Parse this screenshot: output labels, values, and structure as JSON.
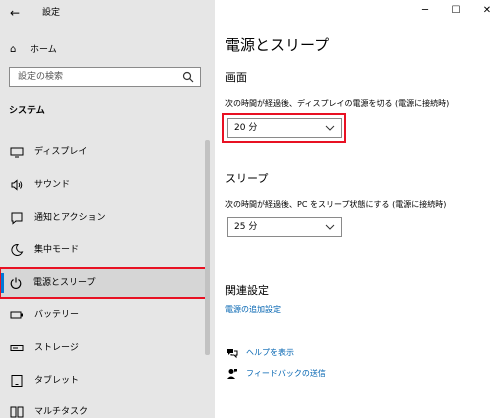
{
  "app": {
    "title": "設定"
  },
  "sidebar": {
    "home_label": "ホーム",
    "search_placeholder": "設定の検索",
    "section": "システム",
    "items": [
      {
        "label": "ディスプレイ",
        "icon": "monitor-icon"
      },
      {
        "label": "サウンド",
        "icon": "speaker-icon"
      },
      {
        "label": "通知とアクション",
        "icon": "notification-icon"
      },
      {
        "label": "集中モード",
        "icon": "moon-icon"
      },
      {
        "label": "電源とスリープ",
        "icon": "power-icon",
        "selected": true
      },
      {
        "label": "バッテリー",
        "icon": "battery-icon"
      },
      {
        "label": "ストレージ",
        "icon": "storage-icon"
      },
      {
        "label": "タブレット",
        "icon": "tablet-icon"
      },
      {
        "label": "マルチタスク",
        "icon": "multitask-icon"
      }
    ]
  },
  "main": {
    "title": "電源とスリープ",
    "screen": {
      "heading": "画面",
      "desc": "次の時間が経過後、ディスプレイの電源を切る (電源に接続時)",
      "value": "20 分"
    },
    "sleep": {
      "heading": "スリープ",
      "desc": "次の時間が経過後、PC をスリープ状態にする (電源に接続時)",
      "value": "25 分"
    },
    "related": {
      "heading": "関連設定",
      "link": "電源の追加設定"
    },
    "help_label": "ヘルプを表示",
    "feedback_label": "フィードバックの送信"
  },
  "colors": {
    "accent": "#0078d7",
    "highlight": "#e81123",
    "link": "#0063b1",
    "sidebar_bg": "#e6e6e6"
  }
}
